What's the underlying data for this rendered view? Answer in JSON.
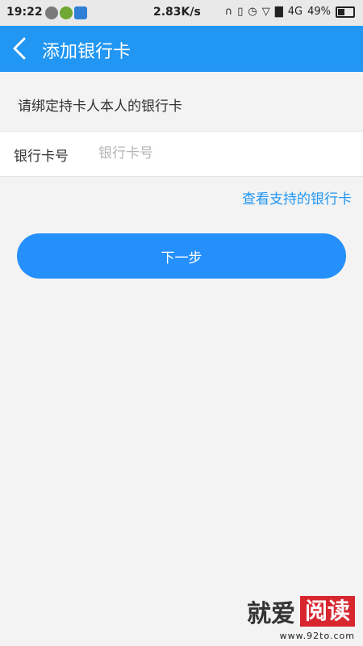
{
  "status_bar": {
    "time": "19:22",
    "net_speed": "2.83K/s",
    "network": "4G",
    "battery": "49%"
  },
  "app_bar": {
    "title": "添加银行卡"
  },
  "form": {
    "hint": "请绑定持卡人本人的银行卡",
    "card_number_label": "银行卡号",
    "card_number_placeholder": "银行卡号",
    "card_number_value": ""
  },
  "supported_banks_link": "查看支持的银行卡",
  "next_button": "下一步",
  "watermark": {
    "brand_left": "就爱",
    "brand_right": "阅读",
    "url": "www.92to.com"
  },
  "colors": {
    "accent": "#2196f3",
    "button": "#2590fb",
    "background": "#f3f3f3"
  }
}
